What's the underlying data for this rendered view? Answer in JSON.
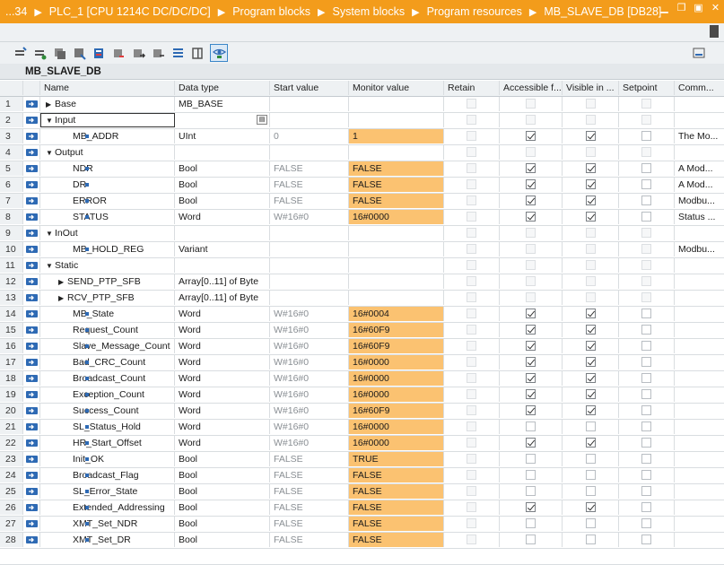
{
  "titlebar": {
    "crumbs": [
      "...34",
      "PLC_1 [CPU 1214C DC/DC/DC]",
      "Program blocks",
      "System blocks",
      "Program resources",
      "MB_SLAVE_DB [DB28]"
    ],
    "accent": "#f39c1b"
  },
  "block_title": "MB_SLAVE_DB",
  "columns": {
    "name": "Name",
    "type": "Data type",
    "start": "Start value",
    "monitor": "Monitor value",
    "retain": "Retain",
    "accessible": "Accessible f...",
    "visible": "Visible in ...",
    "setpoint": "Setpoint",
    "comment": "Comm..."
  },
  "rows": [
    {
      "n": "1",
      "kind": "section",
      "expand": "right",
      "name": "Base",
      "type": "MB_BASE",
      "start": "",
      "mon": "",
      "acc": false,
      "vis": false,
      "com": ""
    },
    {
      "n": "2",
      "kind": "section",
      "expand": "down",
      "name": "Input",
      "type": "",
      "start": "",
      "mon": "",
      "acc": false,
      "vis": false,
      "com": "",
      "selected": true
    },
    {
      "n": "3",
      "kind": "item",
      "name": "MB_ADDR",
      "type": "UInt",
      "start": "0",
      "mon": "1",
      "acc": true,
      "vis": true,
      "com": "The Mo..."
    },
    {
      "n": "4",
      "kind": "section",
      "expand": "down",
      "name": "Output",
      "type": "",
      "start": "",
      "mon": "",
      "acc": false,
      "vis": false,
      "com": ""
    },
    {
      "n": "5",
      "kind": "item",
      "name": "NDR",
      "type": "Bool",
      "start": "FALSE",
      "mon": "FALSE",
      "acc": true,
      "vis": true,
      "com": "A Mod..."
    },
    {
      "n": "6",
      "kind": "item",
      "name": "DR",
      "type": "Bool",
      "start": "FALSE",
      "mon": "FALSE",
      "acc": true,
      "vis": true,
      "com": "A Mod..."
    },
    {
      "n": "7",
      "kind": "item",
      "name": "ERROR",
      "type": "Bool",
      "start": "FALSE",
      "mon": "FALSE",
      "acc": true,
      "vis": true,
      "com": "Modbu..."
    },
    {
      "n": "8",
      "kind": "item",
      "name": "STATUS",
      "type": "Word",
      "start": "W#16#0",
      "mon": "16#0000",
      "acc": true,
      "vis": true,
      "com": "Status ..."
    },
    {
      "n": "9",
      "kind": "section",
      "expand": "down",
      "name": "InOut",
      "type": "",
      "start": "",
      "mon": "",
      "acc": false,
      "vis": false,
      "com": ""
    },
    {
      "n": "10",
      "kind": "item",
      "name": "MB_HOLD_REG",
      "type": "Variant",
      "start": "",
      "mon": "",
      "acc": false,
      "vis": false,
      "com": "Modbu..."
    },
    {
      "n": "11",
      "kind": "section",
      "expand": "down",
      "name": "Static",
      "type": "",
      "start": "",
      "mon": "",
      "acc": false,
      "vis": false,
      "com": ""
    },
    {
      "n": "12",
      "kind": "sub",
      "expand": "right",
      "name": "SEND_PTP_SFB",
      "type": "Array[0..11] of Byte",
      "start": "",
      "mon": "",
      "acc": false,
      "vis": false,
      "com": ""
    },
    {
      "n": "13",
      "kind": "sub",
      "expand": "right",
      "name": "RCV_PTP_SFB",
      "type": "Array[0..11] of Byte",
      "start": "",
      "mon": "",
      "acc": false,
      "vis": false,
      "com": ""
    },
    {
      "n": "14",
      "kind": "item",
      "name": "MB_State",
      "type": "Word",
      "start": "W#16#0",
      "mon": "16#0004",
      "acc": true,
      "vis": true,
      "com": ""
    },
    {
      "n": "15",
      "kind": "item",
      "name": "Request_Count",
      "type": "Word",
      "start": "W#16#0",
      "mon": "16#60F9",
      "acc": true,
      "vis": true,
      "com": ""
    },
    {
      "n": "16",
      "kind": "item",
      "name": "Slave_Message_Count",
      "type": "Word",
      "start": "W#16#0",
      "mon": "16#60F9",
      "acc": true,
      "vis": true,
      "com": ""
    },
    {
      "n": "17",
      "kind": "item",
      "name": "Bad_CRC_Count",
      "type": "Word",
      "start": "W#16#0",
      "mon": "16#0000",
      "acc": true,
      "vis": true,
      "com": ""
    },
    {
      "n": "18",
      "kind": "item",
      "name": "Broadcast_Count",
      "type": "Word",
      "start": "W#16#0",
      "mon": "16#0000",
      "acc": true,
      "vis": true,
      "com": ""
    },
    {
      "n": "19",
      "kind": "item",
      "name": "Exception_Count",
      "type": "Word",
      "start": "W#16#0",
      "mon": "16#0000",
      "acc": true,
      "vis": true,
      "com": ""
    },
    {
      "n": "20",
      "kind": "item",
      "name": "Success_Count",
      "type": "Word",
      "start": "W#16#0",
      "mon": "16#60F9",
      "acc": true,
      "vis": true,
      "com": ""
    },
    {
      "n": "21",
      "kind": "item",
      "name": "SL_Status_Hold",
      "type": "Word",
      "start": "W#16#0",
      "mon": "16#0000",
      "acc": false,
      "vis": false,
      "com": ""
    },
    {
      "n": "22",
      "kind": "item",
      "name": "HR_Start_Offset",
      "type": "Word",
      "start": "W#16#0",
      "mon": "16#0000",
      "acc": true,
      "vis": true,
      "com": ""
    },
    {
      "n": "23",
      "kind": "item",
      "name": "Init_OK",
      "type": "Bool",
      "start": "FALSE",
      "mon": "TRUE",
      "acc": false,
      "vis": false,
      "com": ""
    },
    {
      "n": "24",
      "kind": "item",
      "name": "Broadcast_Flag",
      "type": "Bool",
      "start": "FALSE",
      "mon": "FALSE",
      "acc": false,
      "vis": false,
      "com": ""
    },
    {
      "n": "25",
      "kind": "item",
      "name": "SL_Error_State",
      "type": "Bool",
      "start": "FALSE",
      "mon": "FALSE",
      "acc": false,
      "vis": false,
      "com": ""
    },
    {
      "n": "26",
      "kind": "item",
      "name": "Extended_Addressing",
      "type": "Bool",
      "start": "FALSE",
      "mon": "FALSE",
      "acc": true,
      "vis": true,
      "com": ""
    },
    {
      "n": "27",
      "kind": "item",
      "name": "XMT_Set_NDR",
      "type": "Bool",
      "start": "FALSE",
      "mon": "FALSE",
      "acc": false,
      "vis": false,
      "com": ""
    },
    {
      "n": "28",
      "kind": "item",
      "name": "XMT_Set_DR",
      "type": "Bool",
      "start": "FALSE",
      "mon": "FALSE",
      "acc": false,
      "vis": false,
      "com": ""
    }
  ],
  "colors": {
    "monitor_fill": "#fbc271",
    "icon_blue": "#2e6ab4"
  }
}
